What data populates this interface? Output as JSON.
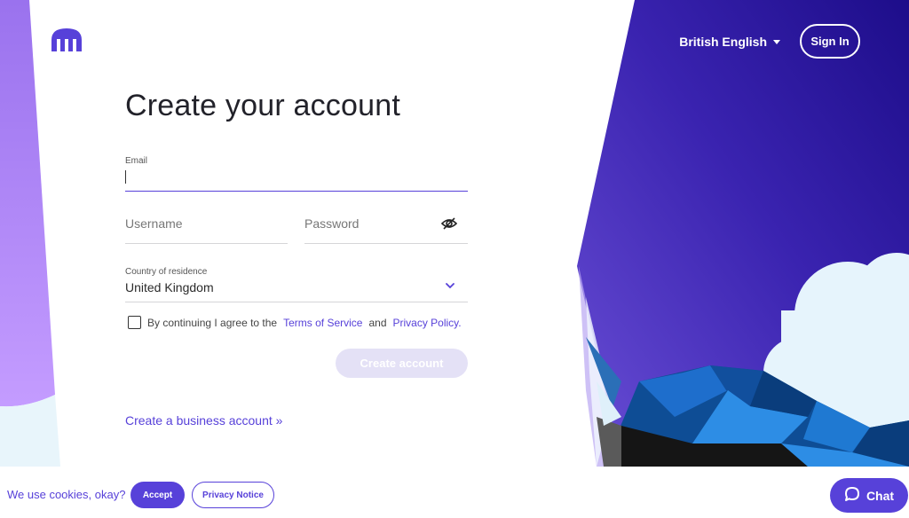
{
  "header": {
    "language": "British English",
    "sign_in": "Sign In"
  },
  "form": {
    "title": "Create your account",
    "email": {
      "label": "Email",
      "value": ""
    },
    "username": {
      "placeholder": "Username",
      "value": ""
    },
    "password": {
      "placeholder": "Password",
      "value": ""
    },
    "country": {
      "label": "Country of residence",
      "value": "United Kingdom"
    },
    "consent": {
      "prefix": "By continuing I agree to the",
      "terms": "Terms of Service",
      "and": "and",
      "privacy": "Privacy Policy.",
      "checked": false
    },
    "submit": "Create account",
    "business_link": "Create a business account »"
  },
  "cookie_banner": {
    "text": "We use cookies, okay?",
    "accept": "Accept",
    "privacy_notice": "Privacy Notice"
  },
  "chat": {
    "label": "Chat"
  },
  "icons": {
    "logo": "kraken-logo",
    "language_caret": "caret-down-icon",
    "password_toggle": "eye-slash-icon",
    "country_select": "chevron-down-icon",
    "chat": "chat-bubble-icon"
  },
  "colors": {
    "accent": "#5741d9",
    "accent_light": "#e4e1f6",
    "panel_dark": "#2e1a9a"
  }
}
